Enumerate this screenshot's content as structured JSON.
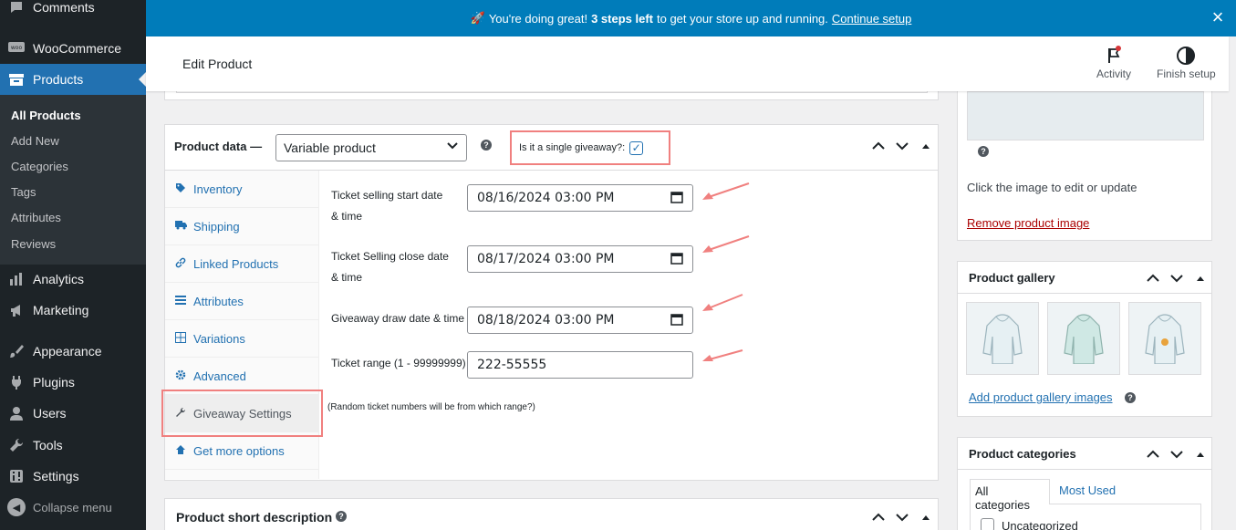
{
  "sidebar": {
    "comments": "Comments",
    "woocommerce": "WooCommerce",
    "products": "Products",
    "submenu": [
      "All Products",
      "Add New",
      "Categories",
      "Tags",
      "Attributes",
      "Reviews"
    ],
    "analytics": "Analytics",
    "marketing": "Marketing",
    "appearance": "Appearance",
    "plugins": "Plugins",
    "users": "Users",
    "tools": "Tools",
    "settings": "Settings",
    "collapse": "Collapse menu"
  },
  "notice": {
    "emoji": "🚀",
    "pre": "You're doing great!",
    "bold": "3 steps left",
    "post": "to get your store up and running.",
    "link": "Continue setup",
    "close": "×"
  },
  "header": {
    "title": "Edit Product",
    "activity": "Activity",
    "finish_setup": "Finish setup"
  },
  "product_data": {
    "title": "Product data —",
    "type": "Variable product",
    "help": "?",
    "giveaway_label": "Is it a single giveaway?:",
    "giveaway_checked": "✓",
    "tabs": [
      "Inventory",
      "Shipping",
      "Linked Products",
      "Attributes",
      "Variations",
      "Advanced",
      "Giveaway Settings",
      "Get more options"
    ],
    "fields": {
      "start_label_1": "Ticket selling start date",
      "start_label_2": "& time",
      "start_value": "08/16/2024 03:00 PM",
      "close_label_1": "Ticket Selling close date",
      "close_label_2": "& time",
      "close_value": "08/17/2024 03:00 PM",
      "draw_label": "Giveaway draw date & time",
      "draw_value": "08/18/2024 03:00 PM",
      "range_label": "Ticket range (1 - 99999999)",
      "range_value": "222-55555",
      "note": "(Random ticket numbers will be from which range?)"
    }
  },
  "short_description": {
    "title": "Product short description",
    "help": "?"
  },
  "product_image": {
    "help": "?",
    "hint": "Click the image to edit or update",
    "remove": "Remove product image"
  },
  "gallery": {
    "title": "Product gallery",
    "add": "Add product gallery images",
    "help": "?"
  },
  "categories": {
    "title": "Product categories",
    "tab_all": "All categories",
    "tab_most": "Most Used",
    "item": "Uncategorized"
  },
  "colors": {
    "admin_bg": "#1d2327",
    "accent": "#2271b1",
    "notice": "#007cba",
    "highlight": "#f0807f"
  }
}
